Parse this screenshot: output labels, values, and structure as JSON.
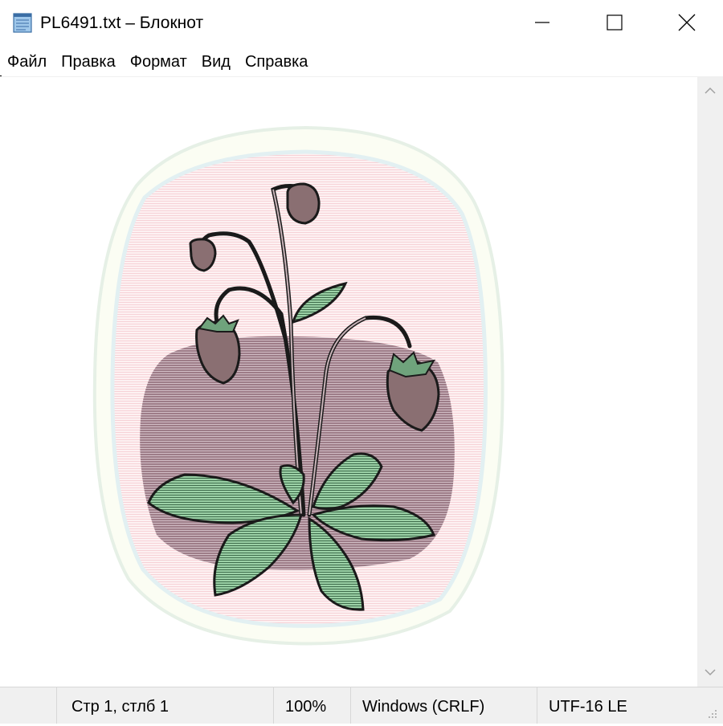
{
  "window": {
    "title": "PL6491.txt – Блокнот",
    "app_icon": "notepad-icon",
    "controls": [
      "minimize-icon",
      "maximize-icon",
      "close-icon"
    ]
  },
  "menu": {
    "items": [
      "Файл",
      "Правка",
      "Формат",
      "Вид",
      "Справка"
    ]
  },
  "editor": {
    "content_image": "strawberry-plant-ascii-art"
  },
  "statusbar": {
    "position": "Стр 1, стлб 1",
    "zoom": "100%",
    "line_ending": "Windows (CRLF)",
    "encoding": "UTF-16 LE"
  },
  "colors": {
    "background_halo": "#fde8ea",
    "mauve_band": "#8d6b78",
    "leaf_green": "#8fc79b",
    "berry": "#8a6f72",
    "outline": "#1a1a1a",
    "statusbar_bg": "#f0f0f0"
  }
}
